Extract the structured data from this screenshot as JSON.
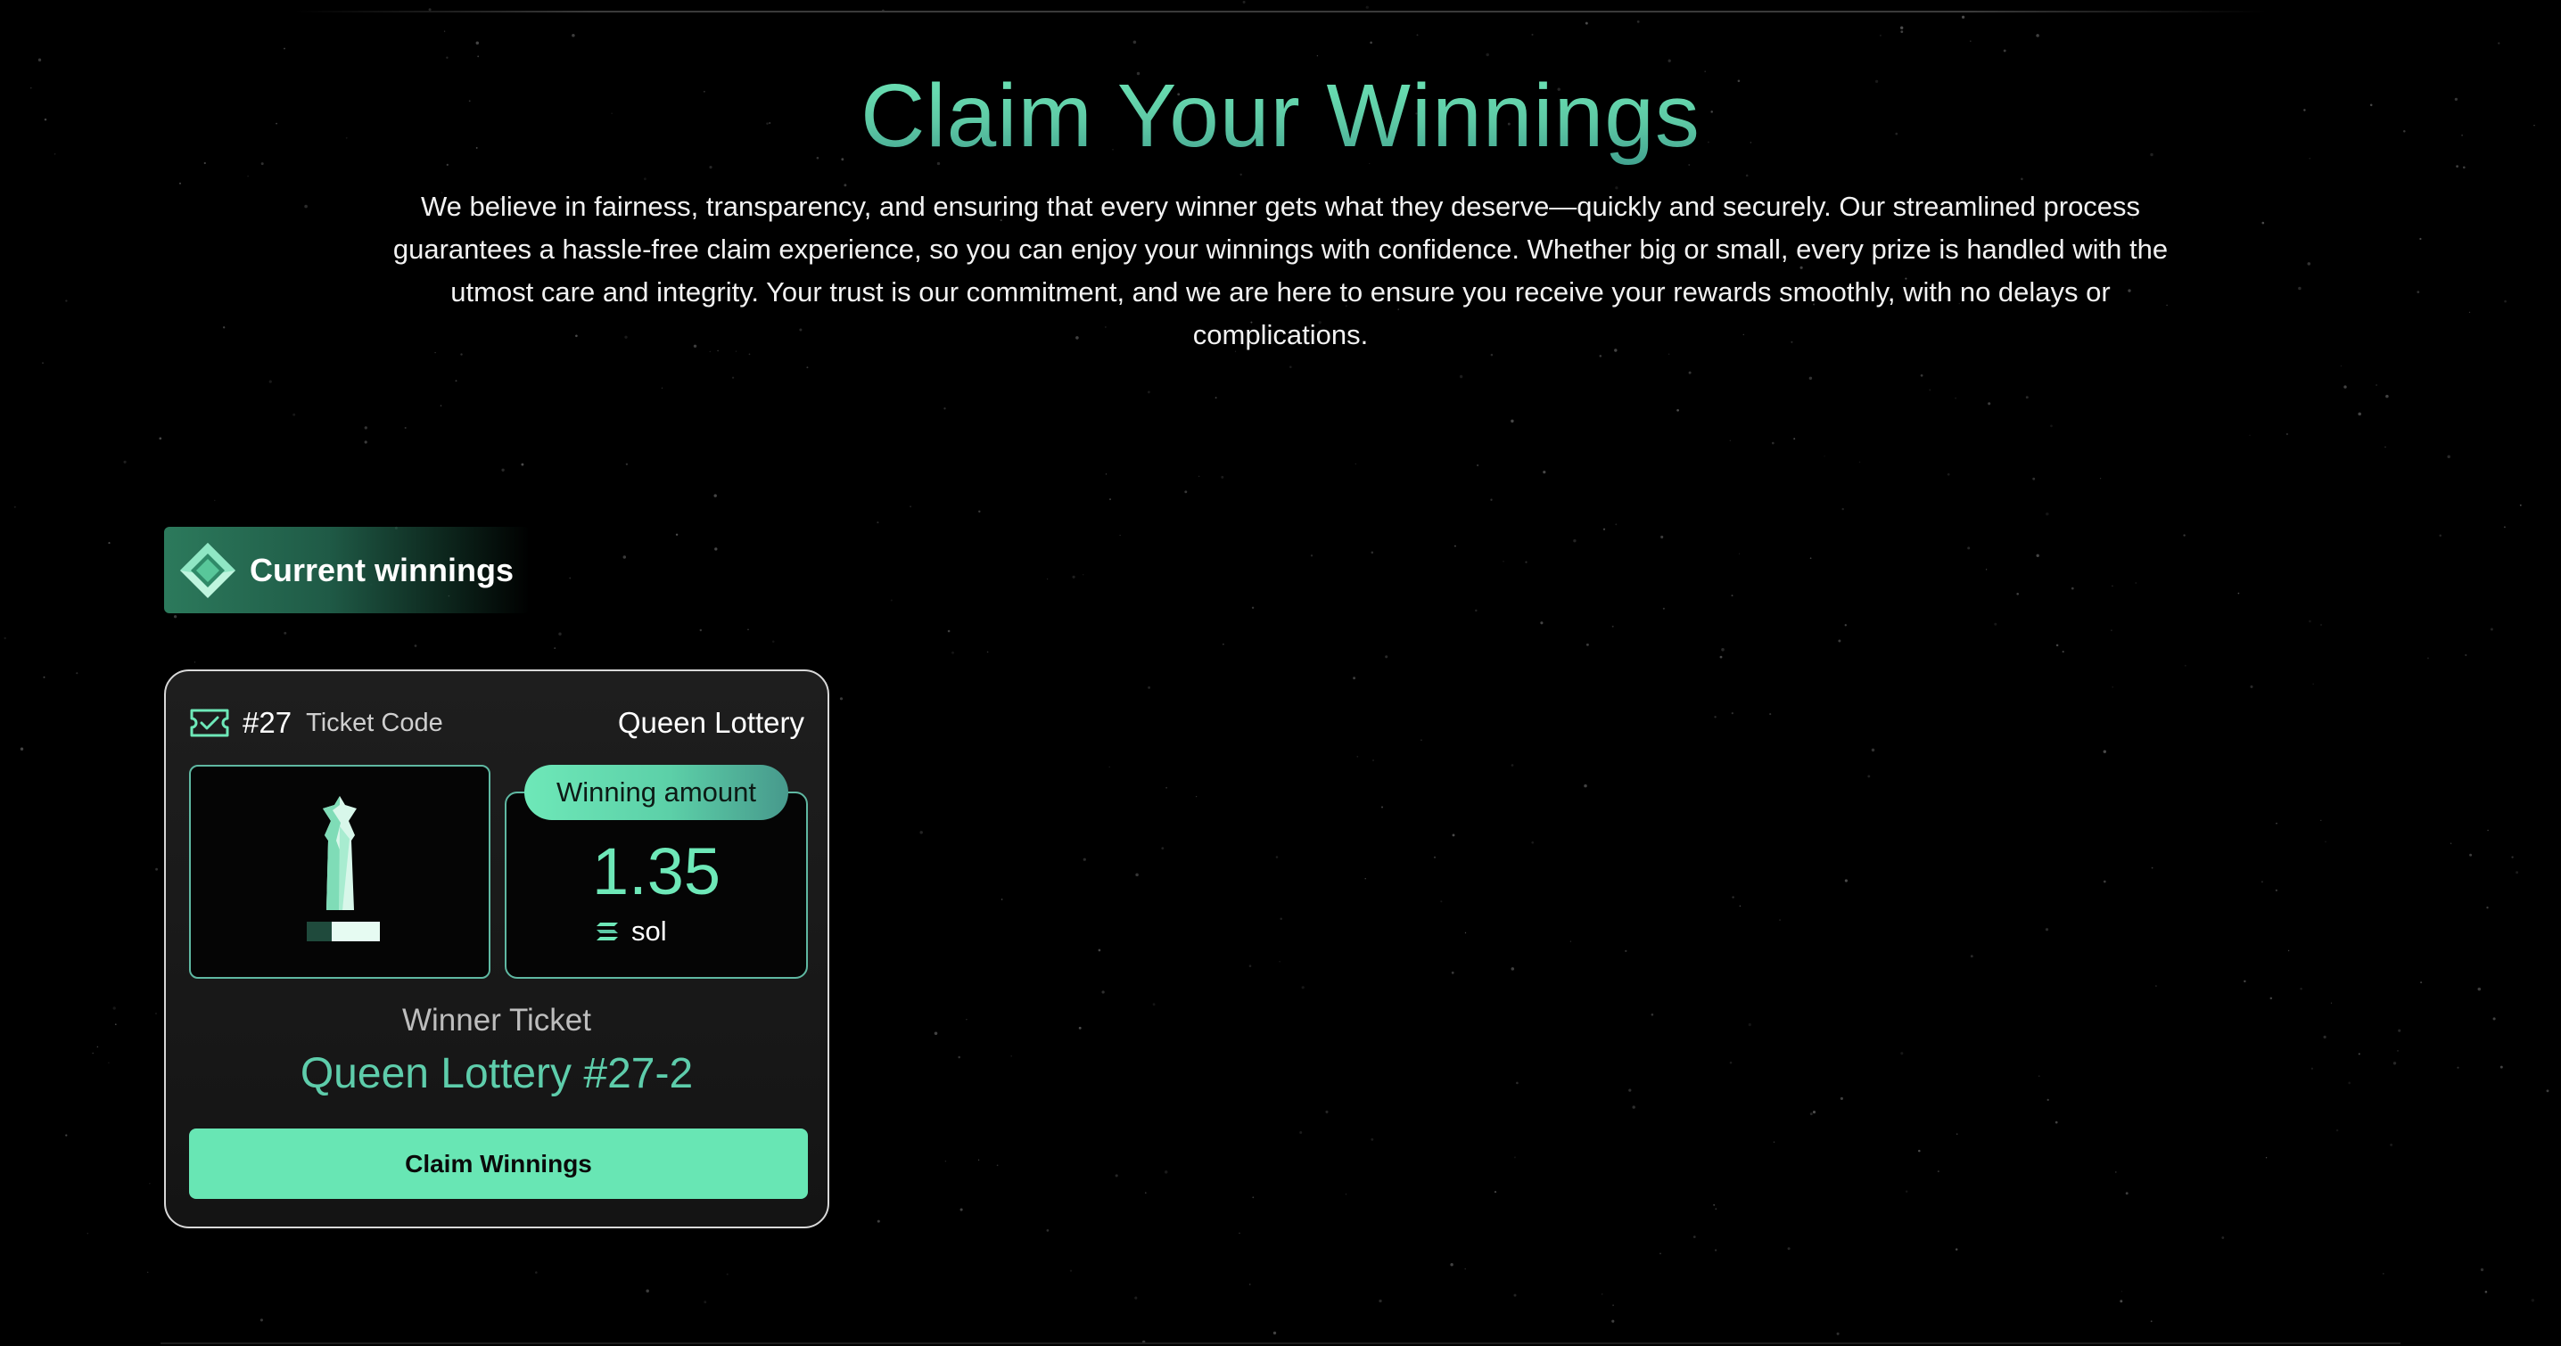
{
  "hero": {
    "title": "Claim Your Winnings",
    "description": "We believe in fairness, transparency, and ensuring that every winner gets what they deserve—quickly and securely. Our streamlined process guarantees a hassle-free claim experience, so you can enjoy your winnings with confidence. Whether big or small, every prize is handled with the utmost care and integrity. Your trust is our commitment, and we are here to ensure you receive your rewards smoothly, with no delays or complications."
  },
  "section": {
    "label": "Current winnings",
    "icon": "diamond-gem-icon"
  },
  "ticket": {
    "number": "#27",
    "code_label": "Ticket Code",
    "lottery_name": "Queen Lottery",
    "image": "chess-queen-icon",
    "amount_label": "Winning amount",
    "amount": "1.35",
    "unit": "sol",
    "unit_icon": "solana-icon",
    "winner_caption": "Winner Ticket",
    "winner_title": "Queen Lottery #27-2",
    "claim_label": "Claim Winnings"
  },
  "colors": {
    "background": "#000000",
    "accent": "#6ee8b8",
    "accent_dark": "#3f9f8d",
    "card_border": "#d8d8d8",
    "box_border": "#5fb8a2"
  }
}
